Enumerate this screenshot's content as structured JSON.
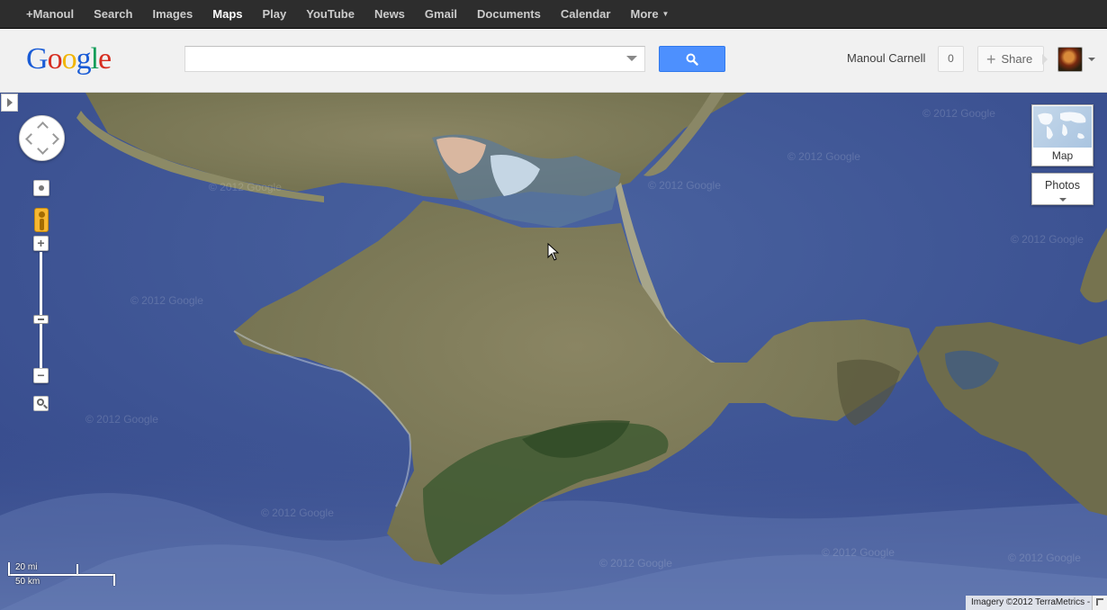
{
  "topbar": {
    "items": [
      {
        "label": "+Manoul",
        "active": false
      },
      {
        "label": "Search",
        "active": false
      },
      {
        "label": "Images",
        "active": false
      },
      {
        "label": "Maps",
        "active": true
      },
      {
        "label": "Play",
        "active": false
      },
      {
        "label": "YouTube",
        "active": false
      },
      {
        "label": "News",
        "active": false
      },
      {
        "label": "Gmail",
        "active": false
      },
      {
        "label": "Documents",
        "active": false
      },
      {
        "label": "Calendar",
        "active": false
      },
      {
        "label": "More",
        "active": false
      }
    ]
  },
  "header": {
    "logo_letters": [
      "G",
      "o",
      "o",
      "g",
      "l",
      "e"
    ],
    "logo_colors": [
      "#1a5cd6",
      "#d62d20",
      "#f1b500",
      "#1a5cd6",
      "#0f9d58",
      "#d62d20"
    ],
    "search_value": "",
    "search_placeholder": "",
    "search_icon": "search-icon",
    "user_name": "Manoul Carnell",
    "notification_count": "0",
    "share_label": "Share"
  },
  "map": {
    "layer_map_label": "Map",
    "layer_photos_label": "Photos",
    "scale_miles": "20 mi",
    "scale_km": "50 km",
    "attribution": "Imagery ©2012 TerraMetrics -",
    "watermark": "© 2012 Google"
  },
  "colors": {
    "topbar_bg": "#2d2d2d",
    "search_button": "#4d90fe",
    "sea": "#3f5590",
    "land": "#7d7a58"
  }
}
